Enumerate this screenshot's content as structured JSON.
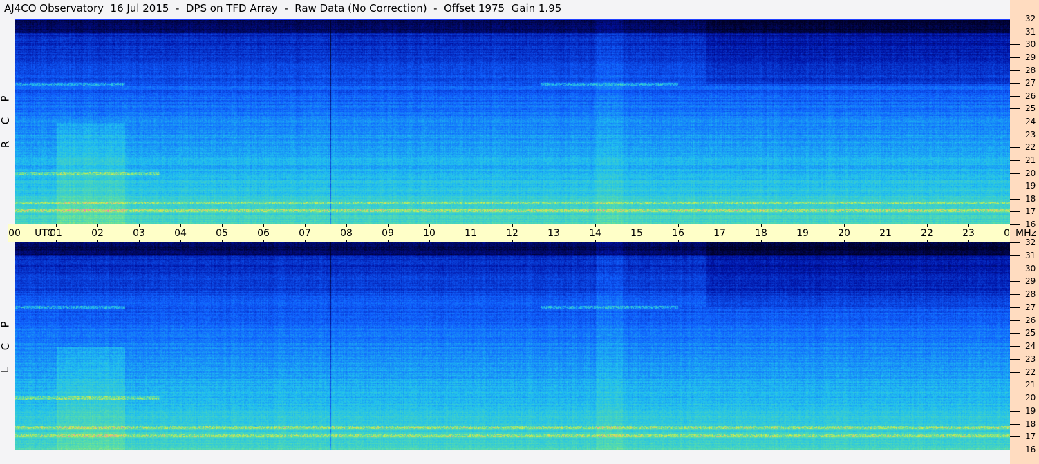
{
  "title": "AJ4CO Observatory  16 Jul 2015  -  DPS on TFD Array  -  Raw Data (No Correction)  -  Offset 1975  Gain 1.95",
  "chart_data": {
    "type": "heatmap",
    "title": "AJ4CO Observatory  16 Jul 2015  -  DPS on TFD Array  -  Raw Data (No Correction)  -  Offset 1975  Gain 1.95",
    "x_axis": {
      "unit_label": "UTC",
      "ticks": [
        "00",
        "01",
        "02",
        "03",
        "04",
        "05",
        "06",
        "07",
        "08",
        "09",
        "10",
        "11",
        "12",
        "13",
        "14",
        "15",
        "16",
        "17",
        "18",
        "19",
        "20",
        "21",
        "22",
        "23",
        "00"
      ],
      "range": [
        "00",
        "24"
      ]
    },
    "y_axis": {
      "unit_label": "MHz",
      "ticks": [
        16,
        17,
        18,
        19,
        20,
        21,
        22,
        23,
        24,
        25,
        26,
        27,
        28,
        29,
        30,
        31,
        32
      ],
      "range": [
        16,
        32
      ]
    },
    "panels": [
      {
        "name": "R C P",
        "letters": [
          "R",
          "C",
          "P"
        ]
      },
      {
        "name": "L C P",
        "letters": [
          "L",
          "C",
          "P"
        ]
      }
    ],
    "colormap": [
      "#000020",
      "#0010a0",
      "#1060ff",
      "#20c0f0",
      "#60e0a0",
      "#e0f040",
      "#ff40ff"
    ],
    "strong_bands_mhz": [
      17.1,
      17.7,
      20.0,
      27.0
    ]
  }
}
